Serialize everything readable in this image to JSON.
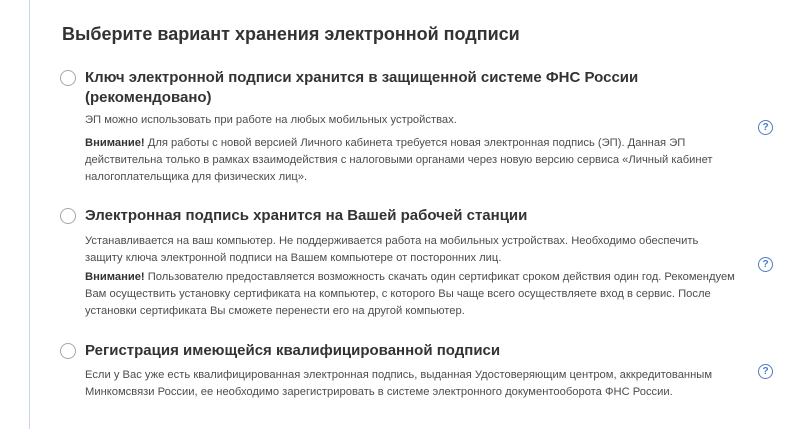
{
  "heading": "Выберите вариант хранения электронной подписи",
  "options": [
    {
      "title": "Ключ электронной подписи хранится в защищенной системе ФНС России (рекомендовано)",
      "description": "ЭП можно использовать при работе на любых мобильных устройствах.",
      "warning_label": "Внимание!",
      "warning_text": " Для работы с новой версией Личного кабинета требуется новая электронная подпись (ЭП). Данная ЭП действительна только в рамках взаимодействия с налоговыми органами через новую версию сервиса «Личный кабинет налогоплательщика для физических лиц».",
      "help_icon": "?"
    },
    {
      "title": "Электронная подпись хранится на Вашей рабочей станции",
      "description": "Устанавливается на ваш компьютер. Не поддерживается работа на мобильных устройствах. Необходимо обеспечить защиту ключа электронной подписи на Вашем компьютере от посторонних лиц.",
      "warning_label": "Внимание!",
      "warning_text": " Пользователю предоставляется возможность скачать один сертификат  сроком действия один год. Рекомендуем Вам осуществить установку сертификата на компьютер, с которого Вы  чаще всего осуществляете вход в сервис. После установки сертификата Вы сможете перенести его на другой  компьютер.",
      "help_icon": "?"
    },
    {
      "title": "Регистрация имеющейся квалифицированной подписи",
      "description": "Если у Вас уже есть квалифицированная электронная подпись, выданная Удостоверяющим центром, аккредитованным Минкомсвязи России, ее необходимо зарегистрировать в системе электронного документооборота ФНС России.",
      "help_icon": "?"
    }
  ],
  "colors": {
    "accent": "#4a7bc5",
    "text": "#333333",
    "muted": "#4d4d4d",
    "radio_border": "#a6a6a6",
    "left_rule": "#c9d6e8"
  }
}
